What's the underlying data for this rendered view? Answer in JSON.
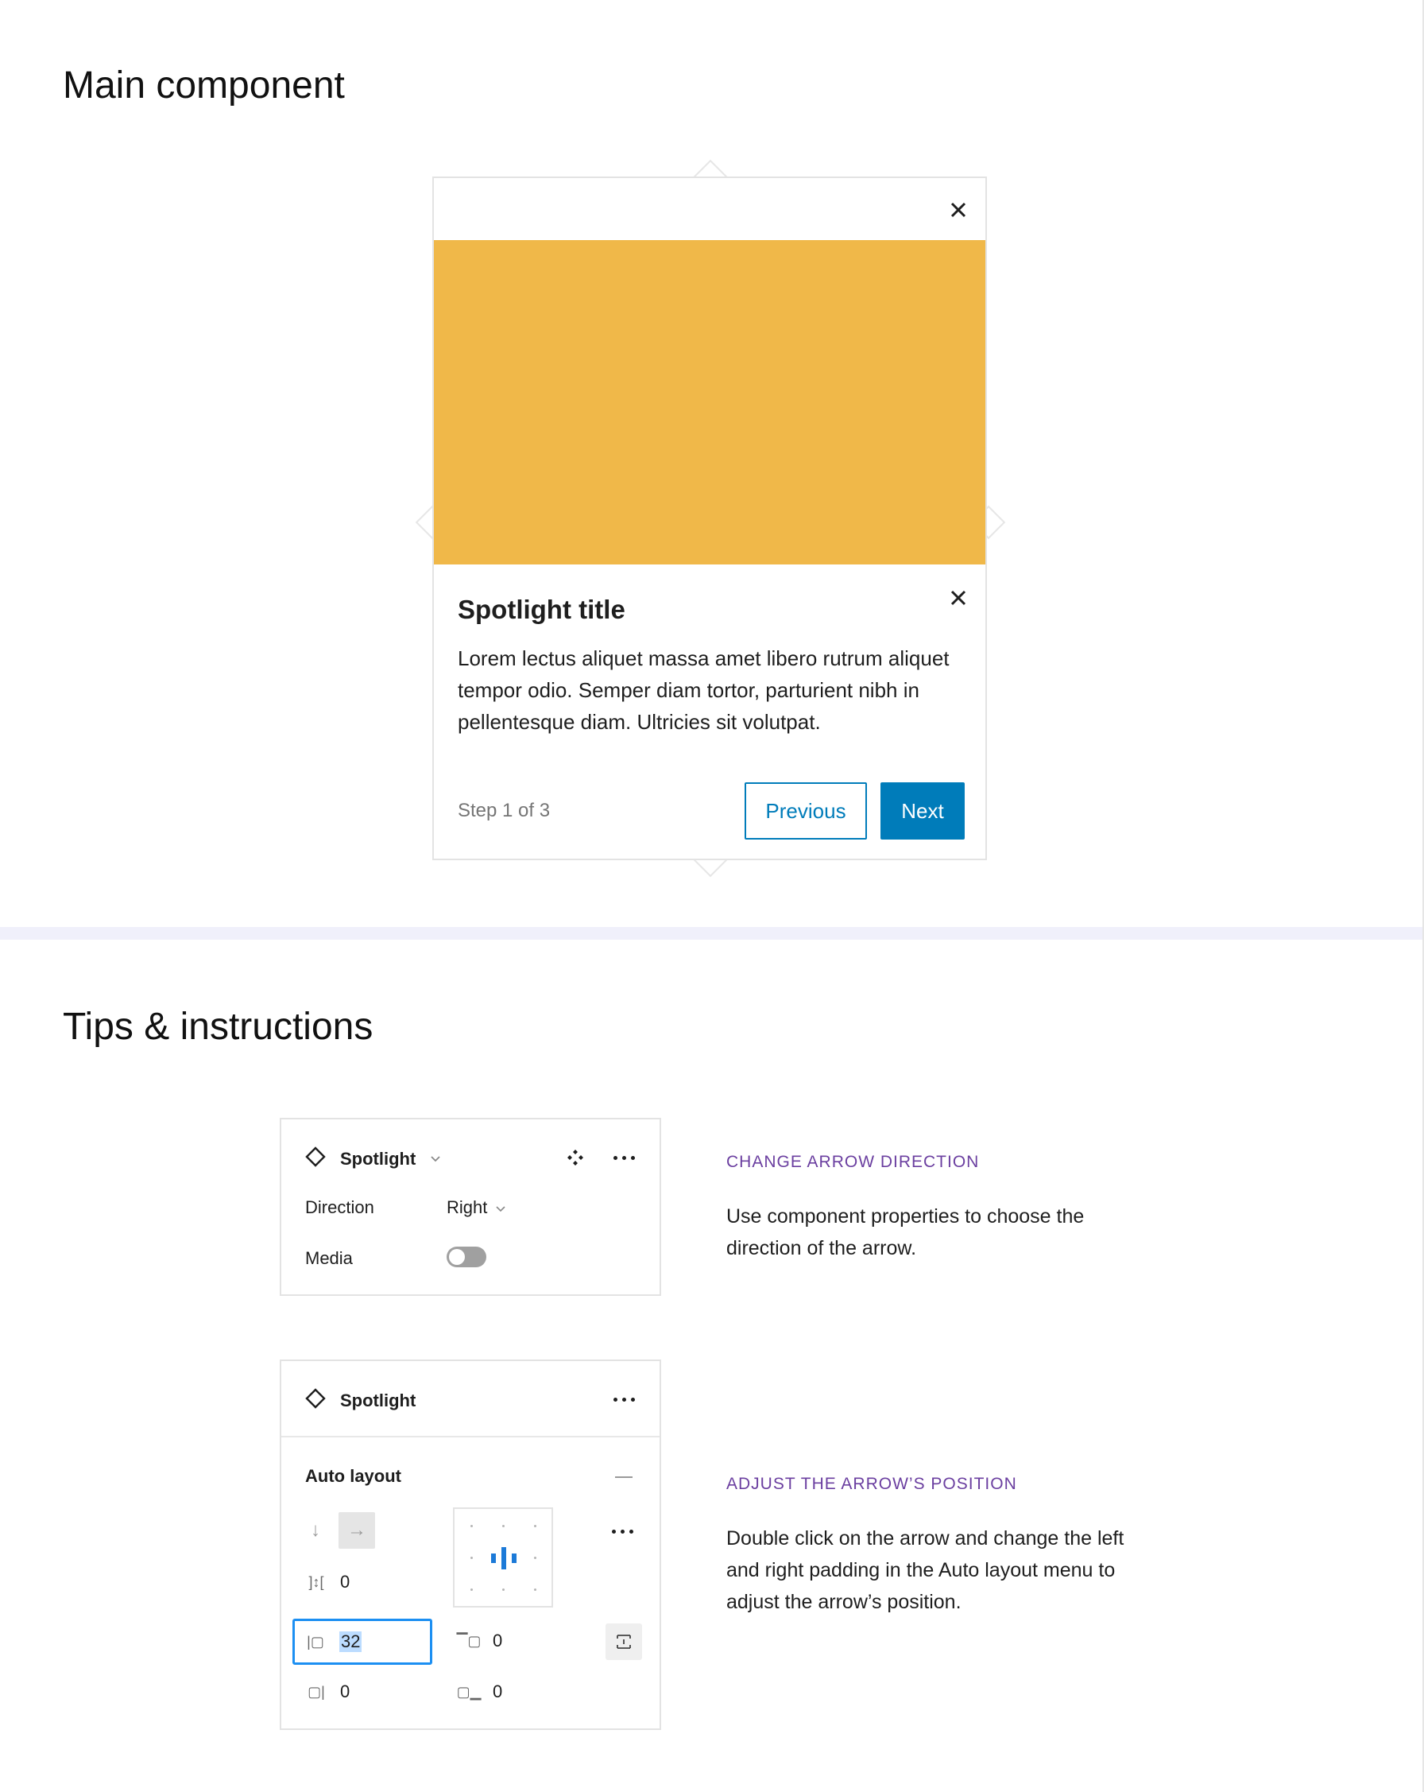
{
  "sections": {
    "main_title": "Main component",
    "tips_title": "Tips & instructions"
  },
  "colors": {
    "media_placeholder": "#f0b849",
    "primary": "#007cba",
    "kicker": "#6b3fa0",
    "divider_band": "#f0f0fb"
  },
  "spotlight": {
    "top_close_icon": "close-icon",
    "title": "Spotlight title",
    "body": "Lorem lectus aliquet massa amet libero rutrum aliquet tempor odio. Semper diam tortor, parturient nibh in pellentesque diam. Ultricies sit volutpat.",
    "step": "Step 1 of 3",
    "previous_label": "Previous",
    "next_label": "Next"
  },
  "panel_properties": {
    "component_name": "Spotlight",
    "direction_label": "Direction",
    "direction_value": "Right",
    "media_label": "Media",
    "media_on": false
  },
  "panel_layout": {
    "component_name": "Spotlight",
    "auto_layout_label": "Auto layout",
    "spacing_value": "0",
    "padding_left_value": "32",
    "padding_top_value": "0",
    "padding_right_value": "0",
    "padding_bottom_value": "0"
  },
  "tips": [
    {
      "kicker": "CHANGE ARROW DIRECTION",
      "text": "Use component properties to choose the direction of the arrow."
    },
    {
      "kicker": "ADJUST THE ARROW’S POSITION",
      "text": "Double click on the arrow and change the left and right padding in the Auto layout menu to adjust the arrow’s position."
    }
  ]
}
